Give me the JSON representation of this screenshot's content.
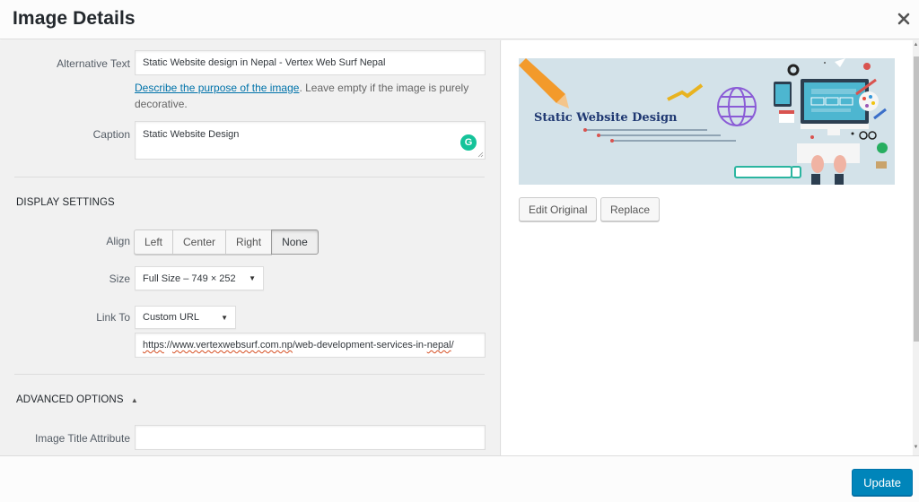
{
  "header": {
    "title": "Image Details",
    "close_icon": "close-icon"
  },
  "attachment": {
    "alt_text": {
      "label": "Alternative Text",
      "value": "Static Website design in Nepal - Vertex Web Surf Nepal"
    },
    "alt_help": {
      "link_text": "Describe the purpose of the image",
      "rest_text": ". Leave empty if the image is purely decorative."
    },
    "caption": {
      "label": "Caption",
      "value": "Static Website Design"
    }
  },
  "display_settings": {
    "title": "Display Settings",
    "align": {
      "label": "Align",
      "options": [
        "Left",
        "Center",
        "Right",
        "None"
      ],
      "selected": "None"
    },
    "size": {
      "label": "Size",
      "value": "Full Size – 749 × 252"
    },
    "link_to": {
      "label": "Link To",
      "value": "Custom URL",
      "url_parts": [
        "https",
        "://",
        "www.vertexwebsurf.com.np",
        "/web-development-services-in-",
        "nepal",
        "/"
      ]
    }
  },
  "advanced_options": {
    "title": "Advanced Options",
    "toggle_icon": "triangle-up-icon",
    "image_title_attribute": {
      "label": "Image Title Attribute",
      "value": ""
    }
  },
  "preview": {
    "image_text": "Static Website Design",
    "edit_original_label": "Edit Original",
    "replace_label": "Replace"
  },
  "footer": {
    "update_label": "Update"
  },
  "colors": {
    "primary_button": "#0085ba",
    "link": "#0073aa",
    "grammarly": "#15c39a"
  }
}
